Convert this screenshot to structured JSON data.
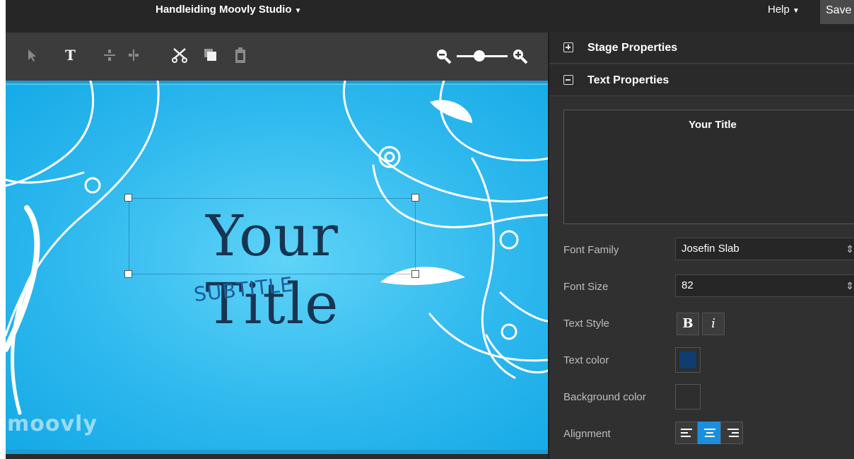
{
  "topbar": {
    "title": "Handleiding Moovly Studio",
    "help_label": "Help",
    "save_label": "Save"
  },
  "toolbar": {
    "tools": [
      "select-tool",
      "text-tool",
      "align-vertical-tool",
      "align-horizontal-tool",
      "cut-tool",
      "copy-tool",
      "paste-tool"
    ],
    "zoom_level": 0.4
  },
  "canvas": {
    "title_text": "Your Title",
    "subtitle_text": "SUBTITLE",
    "watermark": "moovly",
    "background_color": "#2fb9ee",
    "title_color": "#163552",
    "subtitle_color": "#1e5c9b"
  },
  "panel": {
    "stage_properties_label": "Stage Properties",
    "text_properties_label": "Text Properties",
    "preview_text": "Your Title",
    "font_family_label": "Font Family",
    "font_family_value": "Josefin Slab",
    "font_size_label": "Font Size",
    "font_size_value": "82",
    "text_style_label": "Text Style",
    "bold_label": "B",
    "italic_label": "i",
    "text_color_label": "Text color",
    "text_color_value": "#103c6e",
    "background_color_label": "Background color",
    "background_color_value": "#2e2e2e",
    "alignment_label": "Alignment",
    "alignment_selected": "center",
    "accent_color": "#1a8fe0"
  }
}
